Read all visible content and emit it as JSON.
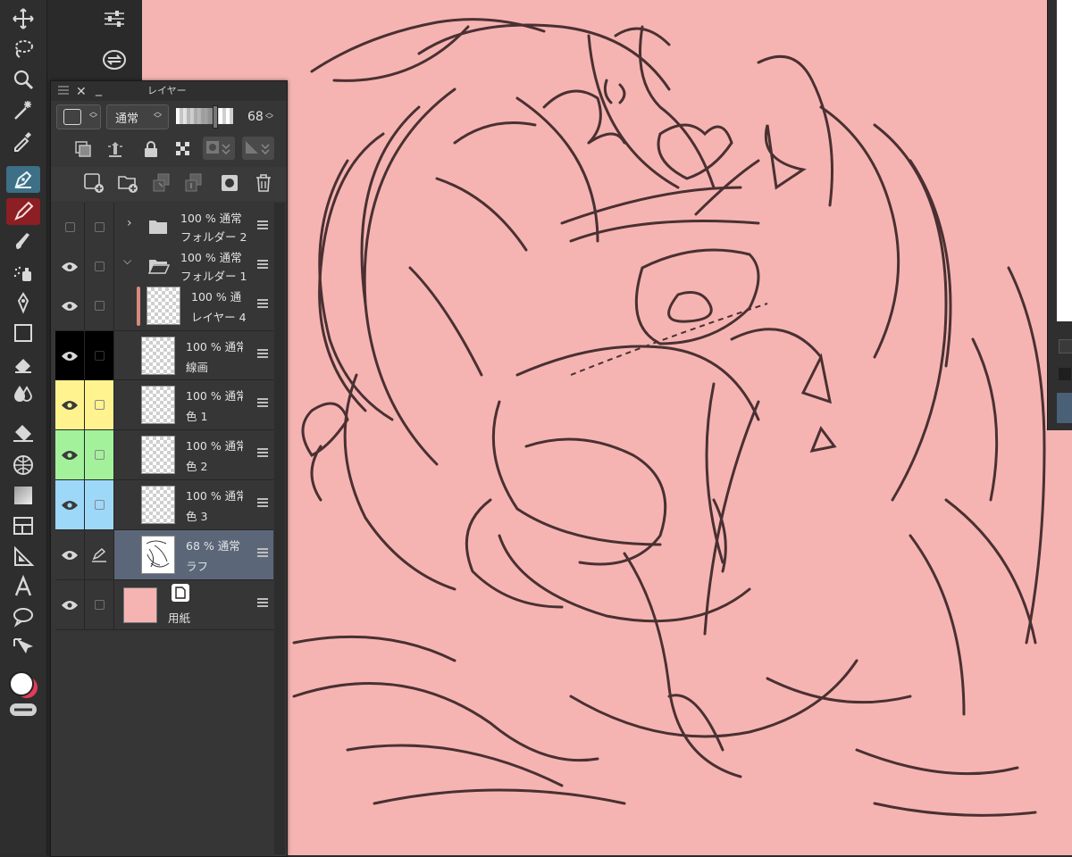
{
  "panel": {
    "title": "レイヤー",
    "blend_mode": "通常",
    "opacity": "68"
  },
  "layers": [
    {
      "info": "100 %  通常",
      "name": "フォルダー 2",
      "type": "folder",
      "collapsed": true,
      "visible": false,
      "color": ""
    },
    {
      "info": "100 %  通常",
      "name": "フォルダー 1",
      "type": "folder",
      "collapsed": false,
      "visible": true,
      "color": ""
    },
    {
      "info": "100 %  通",
      "name": "レイヤー 4",
      "type": "raster",
      "visible": true,
      "color": "",
      "marker": "#d98a7e"
    },
    {
      "info": "100 %  通常",
      "name": "線画",
      "type": "raster",
      "visible": true,
      "color": "#000000"
    },
    {
      "info": "100 %  通常",
      "name": "色 1",
      "type": "raster",
      "visible": true,
      "color": "#fff38f"
    },
    {
      "info": "100 %  通常",
      "name": "色 2",
      "type": "raster",
      "visible": true,
      "color": "#a3f29b"
    },
    {
      "info": "100 %  通常",
      "name": "色 3",
      "type": "raster",
      "visible": true,
      "color": "#9dd8f8"
    },
    {
      "info": "68 %  通常",
      "name": "ラフ",
      "type": "raster",
      "visible": true,
      "color": "",
      "selected": true
    },
    {
      "info": "",
      "name": "用紙",
      "type": "paper",
      "visible": true,
      "color": ""
    }
  ],
  "colors": {
    "canvas": "#f5b4b2",
    "accent": "#3d6f86",
    "selected_row": "#5b6779"
  }
}
